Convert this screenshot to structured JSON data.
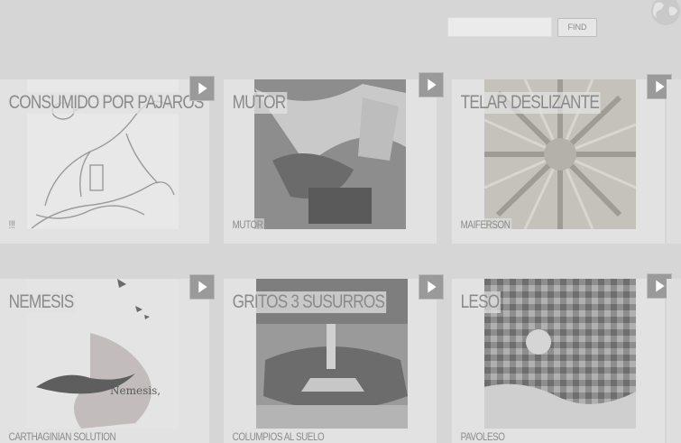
{
  "search": {
    "placeholder": "",
    "value": "",
    "button_label": "FIND"
  },
  "albums": [
    {
      "title": "CONSUMIDO POR PAJAROS",
      "artist": "!!!"
    },
    {
      "title": "MUTOR",
      "artist": "MUTOR"
    },
    {
      "title": "TELAR DESLIZANTE",
      "artist": "MAIFERSON"
    },
    {
      "title": "NEMESIS",
      "artist": "CARTHAGINIAN SOLUTION",
      "cover_text": "Nemesis,"
    },
    {
      "title": "GRITOS 3 SUSURROS",
      "artist": "COLUMPIOS AL SUELO"
    },
    {
      "title": "LESO",
      "artist": "PAVOLESO"
    }
  ],
  "icons": {
    "globe": "globe-icon",
    "play": "play-icon"
  }
}
